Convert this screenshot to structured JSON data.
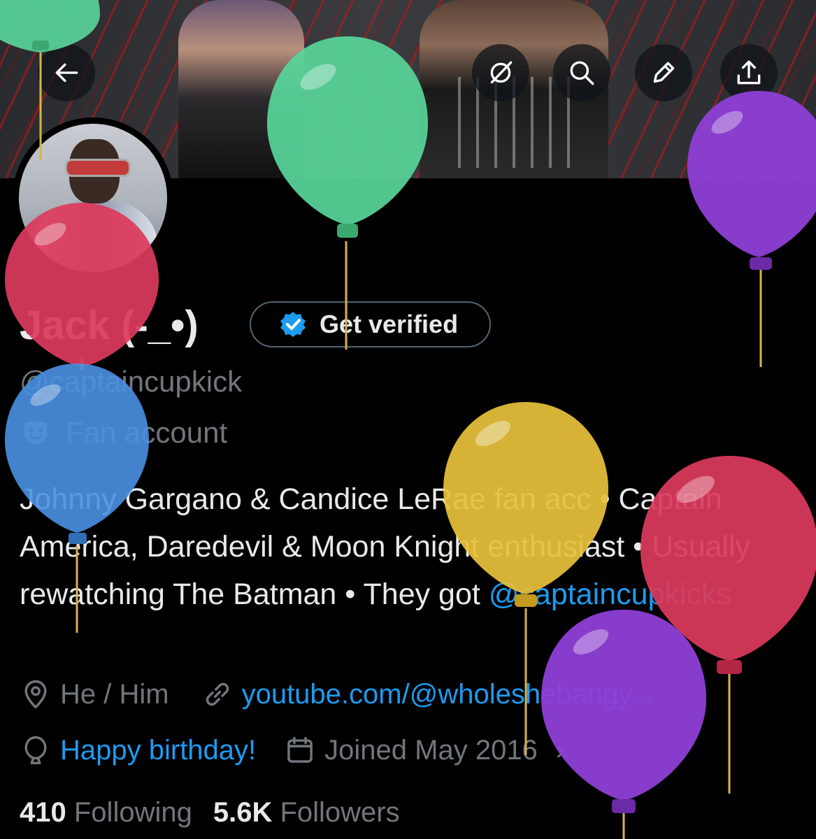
{
  "profile": {
    "display_name": "Jack (-_•)",
    "verify_label": "Get verified",
    "handle": "@captaincupkick",
    "category": "Fan account",
    "bio_text": "Johnny Gargano & Candice LeRae fan acc • Captain America, Daredevil & Moon Knight enthusiast • Usually rewatching The Batman • They got ",
    "bio_mention": "@captaincupkicks",
    "pronouns": "He / Him",
    "website": "youtube.com/@wholeshebangy...",
    "birthday": "Happy birthday!",
    "joined": "Joined May 2016",
    "following_count": "410",
    "following_label": "Following",
    "followers_count": "5.6K",
    "followers_label": "Followers"
  },
  "header_icons": [
    "back-arrow-icon",
    "grok-icon",
    "search-icon",
    "edit-pencil-icon",
    "share-upload-icon"
  ],
  "colors": {
    "background": "#000000",
    "text_primary": "#e7e9ea",
    "text_secondary": "#71767b",
    "accent_link": "#1d9bf0",
    "verified_badge": "#1d9bf0",
    "balloon_green": "#58d49a",
    "balloon_purple": "#8e3fd6",
    "balloon_red": "#dc3a5c",
    "balloon_blue": "#4a90e2",
    "balloon_yellow": "#e6c03a"
  }
}
